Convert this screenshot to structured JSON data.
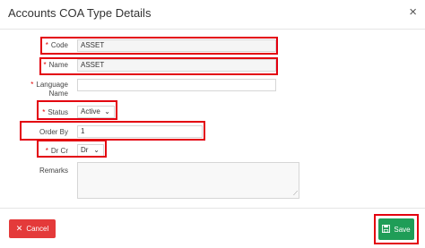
{
  "dialog": {
    "title": "Accounts COA Type Details",
    "close_icon": "×"
  },
  "form": {
    "code": {
      "label": "Code",
      "value": "ASSET",
      "required": true
    },
    "name": {
      "label": "Name",
      "value": "ASSET",
      "required": true
    },
    "language_name": {
      "label_line1": "Language",
      "label_line2": "Name",
      "value": "",
      "required": true
    },
    "status": {
      "label": "Status",
      "value": "Active",
      "required": true
    },
    "order_by": {
      "label": "Order By",
      "value": "1",
      "required": false
    },
    "dr_cr": {
      "label": "Dr Cr",
      "value": "Dr",
      "required": true
    },
    "remarks": {
      "label": "Remarks",
      "value": ""
    }
  },
  "buttons": {
    "cancel": {
      "label": "Cancel",
      "icon": "close-icon",
      "color": "#e43a3a"
    },
    "save": {
      "label": "Save",
      "icon": "save-icon",
      "color": "#1f9d57"
    }
  },
  "highlight_color": "#e3000f",
  "required_marker": "*"
}
